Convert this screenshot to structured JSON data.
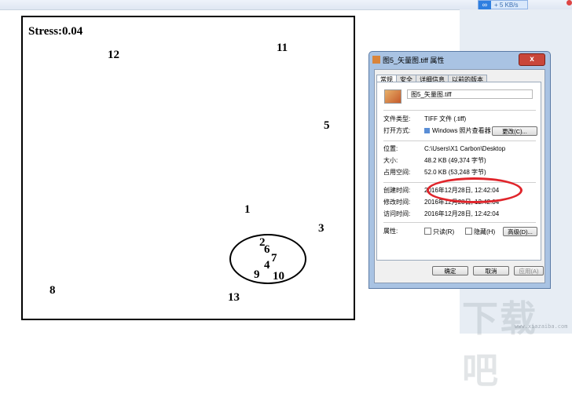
{
  "topbar": {
    "speed": "+ 5 KB/s",
    "net_icon": "link-icon"
  },
  "plot": {
    "stress_label": "Stress:0.04",
    "points": [
      {
        "id": "12",
        "label": "12"
      },
      {
        "id": "11",
        "label": "11"
      },
      {
        "id": "5",
        "label": "5"
      },
      {
        "id": "1",
        "label": "1"
      },
      {
        "id": "3",
        "label": "3"
      },
      {
        "id": "2",
        "label": "2"
      },
      {
        "id": "6",
        "label": "6"
      },
      {
        "id": "7",
        "label": "7"
      },
      {
        "id": "4",
        "label": "4"
      },
      {
        "id": "9",
        "label": "9"
      },
      {
        "id": "10",
        "label": "10"
      },
      {
        "id": "8",
        "label": "8"
      },
      {
        "id": "13",
        "label": "13"
      }
    ]
  },
  "dialog": {
    "title": "图5_矢量图.tiff 属性",
    "close_label": "x",
    "tabs": [
      "常规",
      "安全",
      "详细信息",
      "以前的版本"
    ],
    "filename": "图5_矢量图.tiff",
    "file_type_label": "文件类型:",
    "file_type_value": "TIFF 文件 (.tiff)",
    "open_with_label": "打开方式:",
    "open_with_value": "Windows 照片查看器",
    "change_button": "更改(C)...",
    "location_label": "位置:",
    "location_value": "C:\\Users\\X1 Carbon\\Desktop",
    "size_label": "大小:",
    "size_value": "48.2 KB (49,374 字节)",
    "disk_size_label": "占用空间:",
    "disk_size_value": "52.0 KB (53,248 字节)",
    "created_label": "创建时间:",
    "created_value": "2016年12月28日, 12:42:04",
    "modified_label": "修改时间:",
    "modified_value": "2016年12月28日, 12:42:04",
    "accessed_label": "访问时间:",
    "accessed_value": "2016年12月28日, 12:42:04",
    "attributes_label": "属性:",
    "readonly_label": "只读(R)",
    "hidden_label": "隐藏(H)",
    "advanced_button": "高级(D)...",
    "ok_button": "确定",
    "cancel_button": "取消",
    "apply_button": "应用(A)"
  },
  "watermark": {
    "text": "下载吧",
    "url": "www.xiazaiba.com"
  },
  "colors": {
    "highlight_oval": "#e0252b",
    "dialog_frame": "#a9c3e3"
  }
}
